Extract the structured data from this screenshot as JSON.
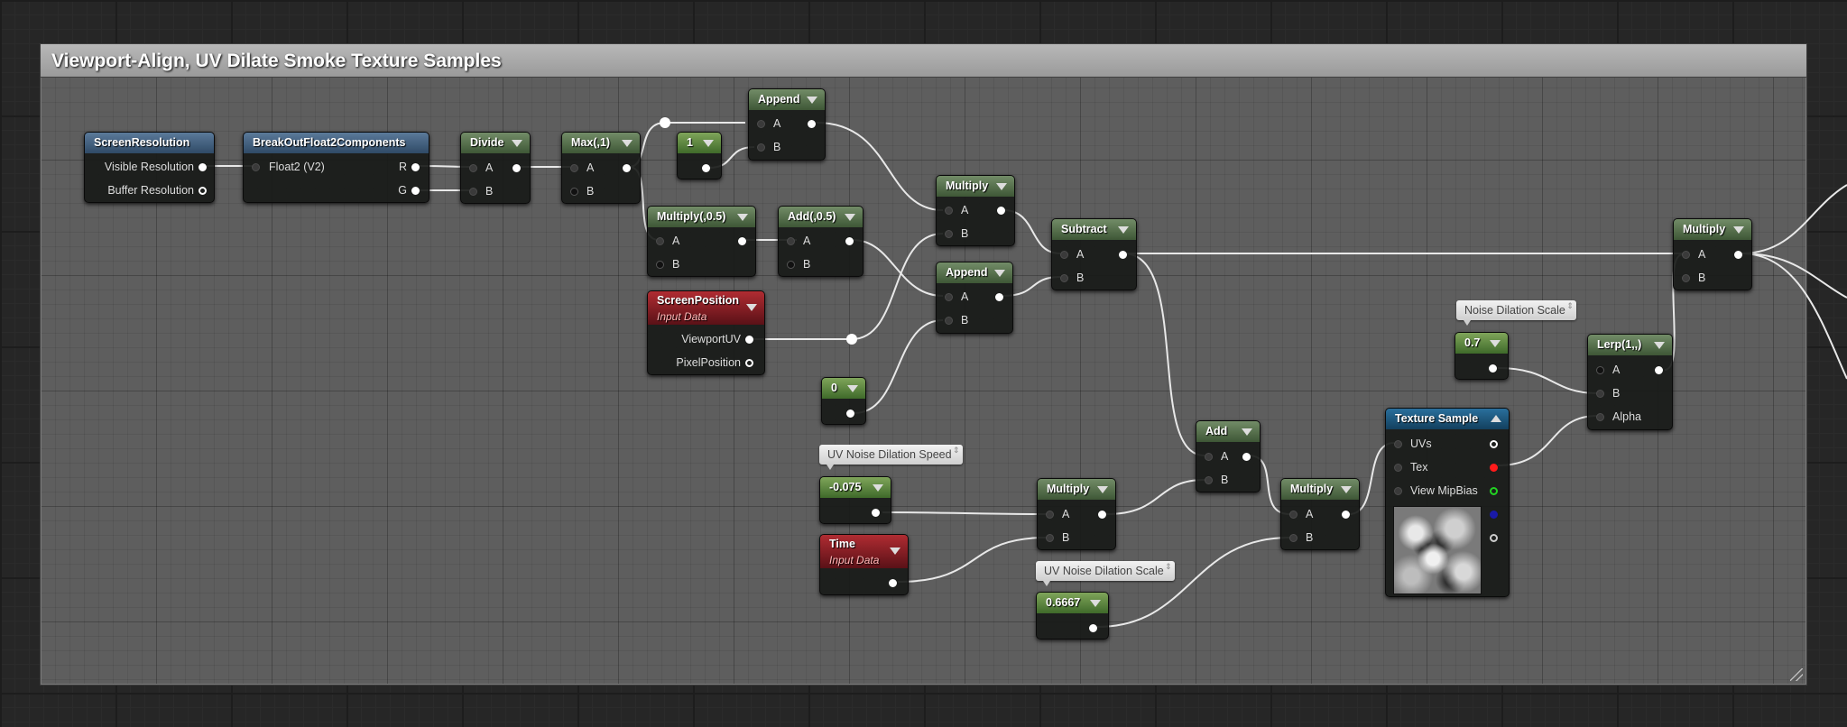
{
  "comment_box": {
    "title": "Viewport-Align, UV Dilate Smoke Texture Samples"
  },
  "nodes": {
    "screen_resolution": {
      "title": "ScreenResolution",
      "outputs": [
        "Visible Resolution",
        "Buffer Resolution"
      ]
    },
    "break_out_float2": {
      "title": "BreakOutFloat2Components",
      "input": "Float2 (V2)",
      "outputs": [
        "R",
        "G"
      ]
    },
    "divide": {
      "title": "Divide",
      "inputs": [
        "A",
        "B"
      ]
    },
    "max": {
      "title": "Max(,1)",
      "inputs": [
        "A",
        "B"
      ]
    },
    "const_1": {
      "title": "1"
    },
    "append_top": {
      "title": "Append",
      "inputs": [
        "A",
        "B"
      ]
    },
    "multiply_half": {
      "title": "Multiply(,0.5)",
      "inputs": [
        "A",
        "B"
      ]
    },
    "add_half": {
      "title": "Add(,0.5)",
      "inputs": [
        "A",
        "B"
      ]
    },
    "multiply_mid": {
      "title": "Multiply",
      "inputs": [
        "A",
        "B"
      ]
    },
    "append_mid": {
      "title": "Append",
      "inputs": [
        "A",
        "B"
      ]
    },
    "subtract": {
      "title": "Subtract",
      "inputs": [
        "A",
        "B"
      ]
    },
    "screen_position": {
      "title": "ScreenPosition",
      "subtitle": "Input Data",
      "outputs": [
        "ViewportUV",
        "PixelPosition"
      ]
    },
    "const_0": {
      "title": "0"
    },
    "const_speed": {
      "title": "-0.075",
      "comment": "UV Noise Dilation Speed"
    },
    "time": {
      "title": "Time",
      "subtitle": "Input Data"
    },
    "multiply_time": {
      "title": "Multiply",
      "inputs": [
        "A",
        "B"
      ]
    },
    "const_scale": {
      "title": "0.6667",
      "comment": "UV Noise Dilation Scale"
    },
    "add_bottom": {
      "title": "Add",
      "inputs": [
        "A",
        "B"
      ]
    },
    "multiply_bottom": {
      "title": "Multiply",
      "inputs": [
        "A",
        "B"
      ]
    },
    "texture_sample": {
      "title": "Texture Sample",
      "inputs": [
        "UVs",
        "Tex",
        "View MipBias"
      ]
    },
    "const_07": {
      "title": "0.7",
      "comment": "Noise Dilation Scale"
    },
    "lerp": {
      "title": "Lerp(1,,)",
      "inputs": [
        "A",
        "B",
        "Alpha"
      ]
    },
    "multiply_final": {
      "title": "Multiply",
      "inputs": [
        "A",
        "B"
      ]
    }
  },
  "colors": {
    "tex_pin_red": "#ff1b1b",
    "tex_pin_green": "#22d322",
    "tex_pin_blue": "#1a1aa8",
    "wire": "#ffffff"
  }
}
